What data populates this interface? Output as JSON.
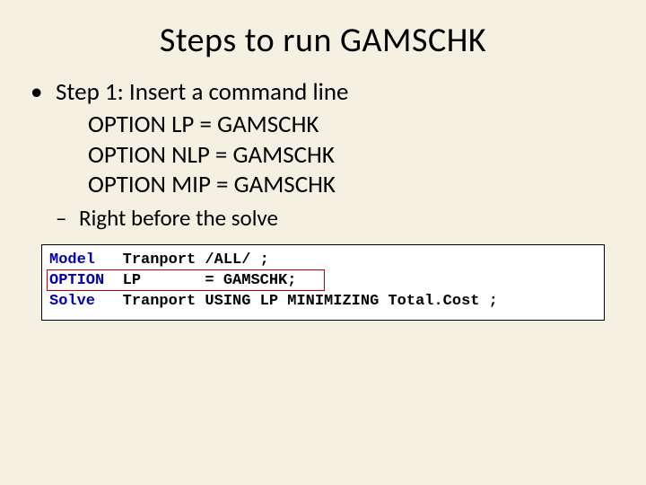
{
  "title": "Steps to run GAMSCHK",
  "bullet_mark": "•",
  "step1": "Step 1: Insert a command line",
  "opt1": "OPTION LP = GAMSCHK",
  "opt2": "OPTION NLP = GAMSCHK",
  "opt3": "OPTION MIP = GAMSCHK",
  "sub_mark": "–",
  "sub1": "Right before the solve",
  "code": {
    "l1_kw": "Model",
    "l1_rest": "   Tranport /ALL/ ;",
    "l2_kw": "OPTION",
    "l2_rest": "  LP       = GAMSCHK;",
    "l3_kw": "Solve",
    "l3_rest": "   Tranport USING LP MINIMIZING Total.Cost ;"
  }
}
